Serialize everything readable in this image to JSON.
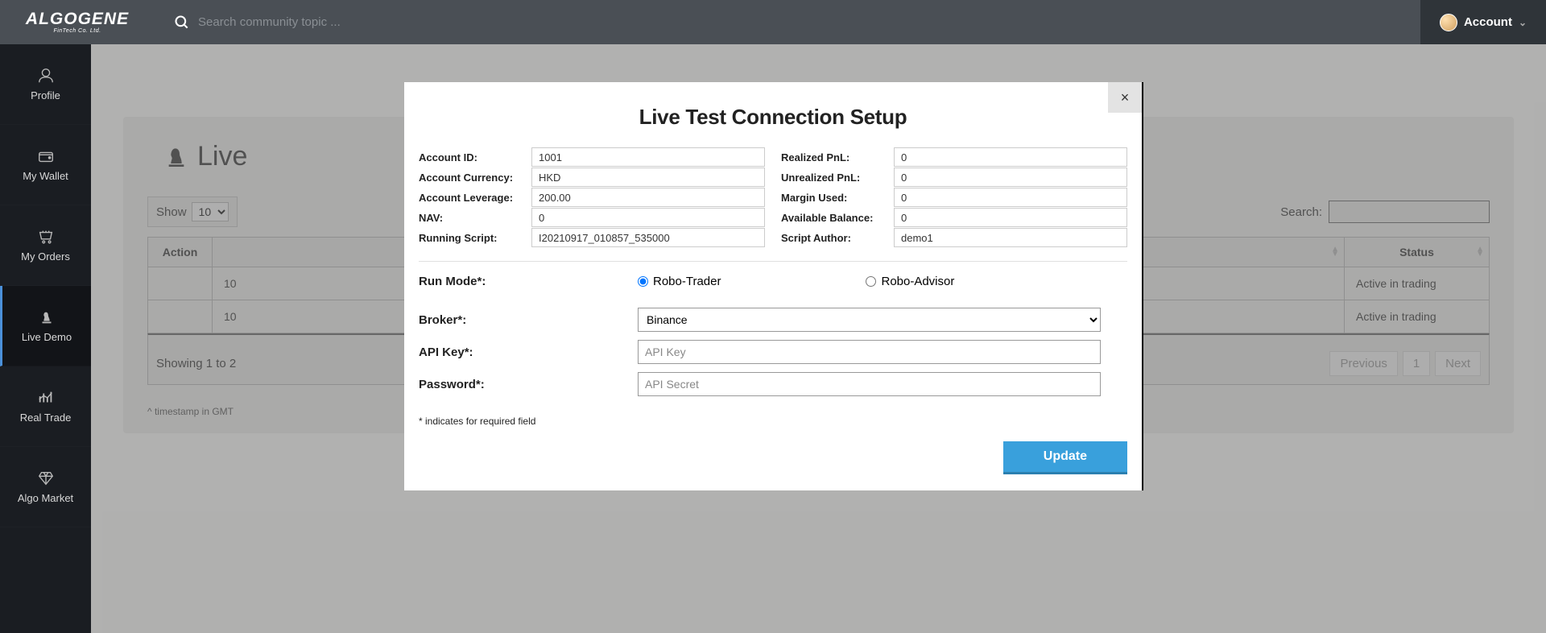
{
  "header": {
    "brand_main": "ALGOGENE",
    "brand_sub": "FinTech Co. Ltd.",
    "search_placeholder": "Search community topic ...",
    "account_label": "Account"
  },
  "sidebar": {
    "items": [
      {
        "label": "Profile"
      },
      {
        "label": "My Wallet"
      },
      {
        "label": "My Orders"
      },
      {
        "label": "Live Demo"
      },
      {
        "label": "Real Trade"
      },
      {
        "label": "Algo Market"
      }
    ]
  },
  "page": {
    "title": "Live",
    "show_label": "Show",
    "show_value": "10",
    "search_label": "Search:",
    "columns": {
      "action": "Action",
      "status": "Status"
    },
    "rows": [
      {
        "col1": "10",
        "status": "Active in trading"
      },
      {
        "col1": "10",
        "status": "Active in trading"
      }
    ],
    "footer_text": "Showing 1 to 2",
    "prev": "Previous",
    "page_num": "1",
    "next": "Next",
    "footnote": "^ timestamp in GMT"
  },
  "modal": {
    "title": "Live Test Connection Setup",
    "close": "×",
    "info_left": [
      {
        "label": "Account ID:",
        "value": "1001"
      },
      {
        "label": "Account Currency:",
        "value": "HKD"
      },
      {
        "label": "Account Leverage:",
        "value": "200.00"
      },
      {
        "label": "NAV:",
        "value": "0"
      },
      {
        "label": "Running Script:",
        "value": "I20210917_010857_535000"
      }
    ],
    "info_right": [
      {
        "label": "Realized PnL:",
        "value": "0"
      },
      {
        "label": "Unrealized PnL:",
        "value": "0"
      },
      {
        "label": "Margin Used:",
        "value": "0"
      },
      {
        "label": "Available Balance:",
        "value": "0"
      },
      {
        "label": "Script Author:",
        "value": "demo1"
      }
    ],
    "run_mode_label": "Run Mode*:",
    "run_mode_options": [
      "Robo-Trader",
      "Robo-Advisor"
    ],
    "broker_label": "Broker*:",
    "broker_value": "Binance",
    "api_key_label": "API Key*:",
    "api_key_placeholder": "API Key",
    "password_label": "Password*:",
    "password_placeholder": "API Secret",
    "required_note": "* indicates for required field",
    "update_btn": "Update"
  }
}
